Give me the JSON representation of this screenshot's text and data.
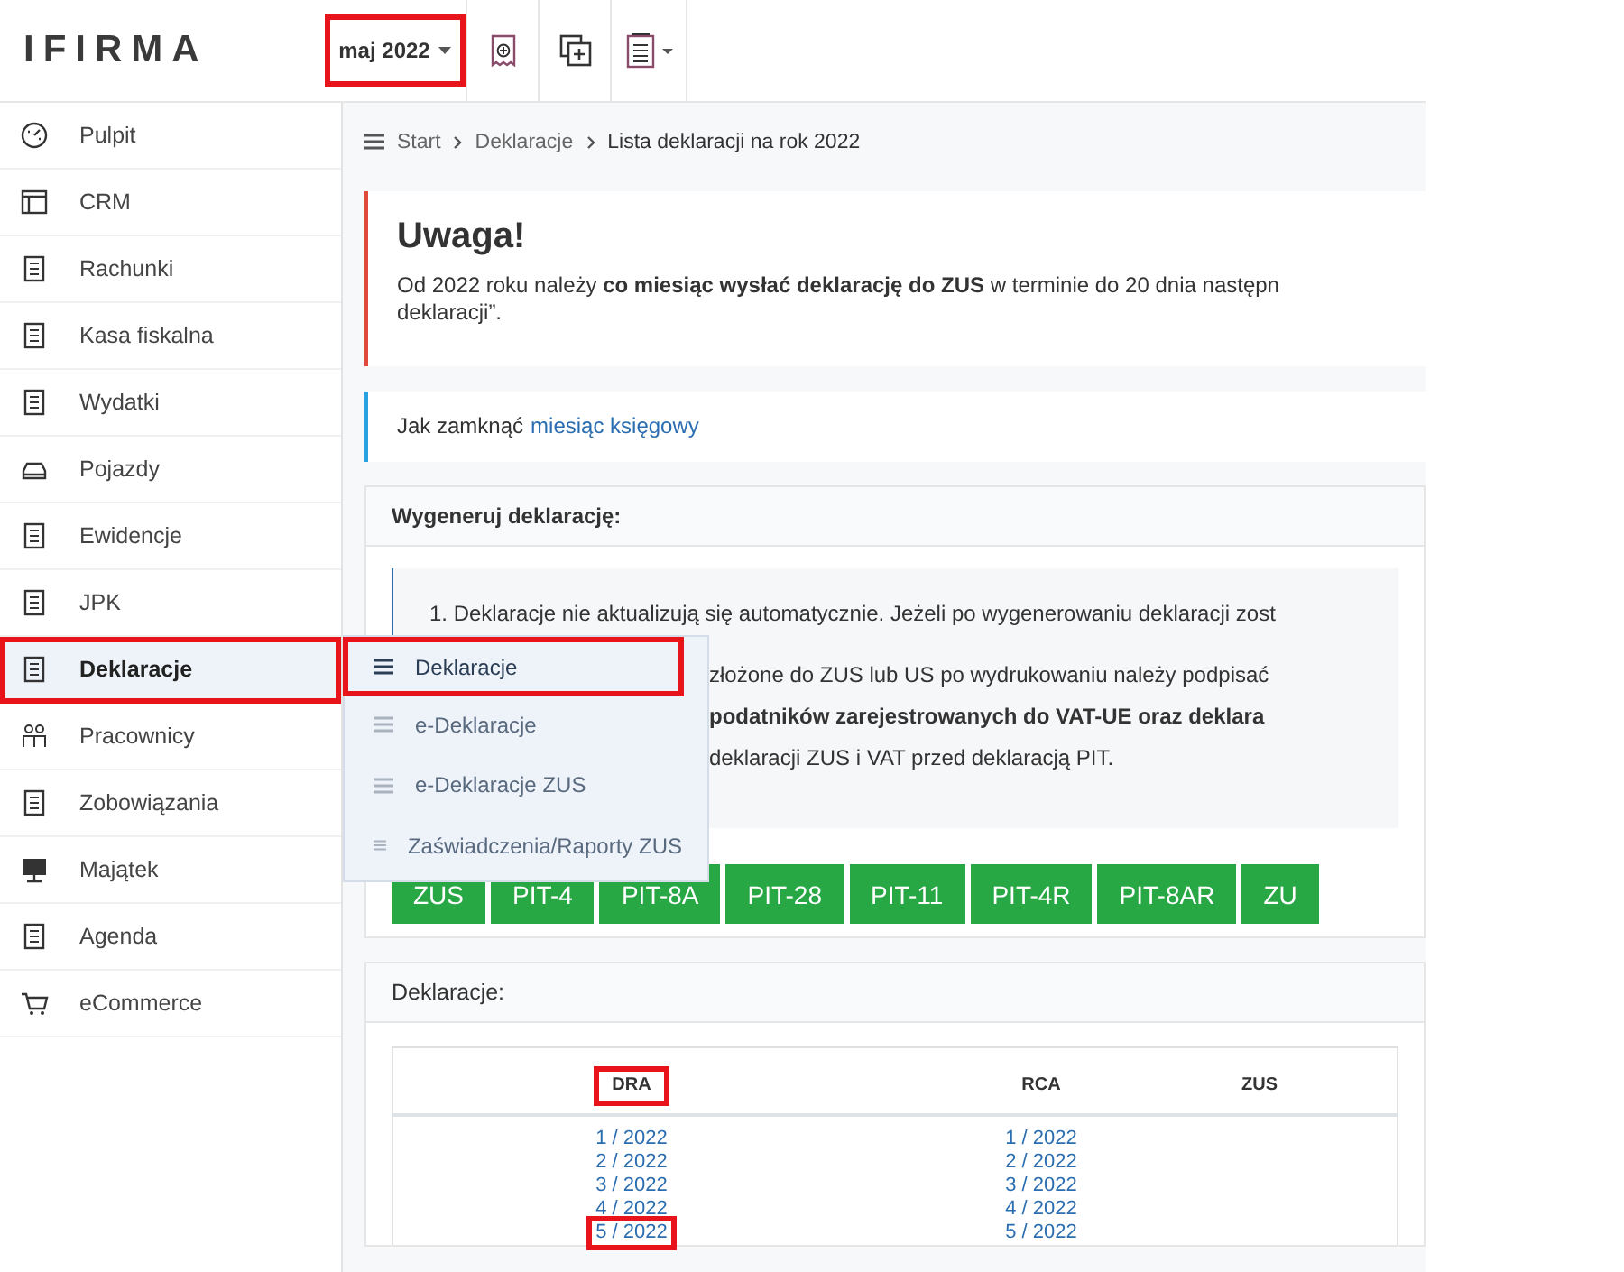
{
  "header": {
    "logo": "IFIRMA",
    "month": {
      "label": "maj 2022",
      "highlighted": true
    }
  },
  "sidebar": {
    "items": [
      {
        "label": "Pulpit",
        "selected": false,
        "highlighted": false
      },
      {
        "label": "CRM",
        "selected": false,
        "highlighted": false
      },
      {
        "label": "Rachunki",
        "selected": false,
        "highlighted": false
      },
      {
        "label": "Kasa fiskalna",
        "selected": false,
        "highlighted": false
      },
      {
        "label": "Wydatki",
        "selected": false,
        "highlighted": false
      },
      {
        "label": "Pojazdy",
        "selected": false,
        "highlighted": false
      },
      {
        "label": "Ewidencje",
        "selected": false,
        "highlighted": false
      },
      {
        "label": "JPK",
        "selected": false,
        "highlighted": false
      },
      {
        "label": "Deklaracje",
        "selected": true,
        "highlighted": true
      },
      {
        "label": "Pracownicy",
        "selected": false,
        "highlighted": false
      },
      {
        "label": "Zobowiązania",
        "selected": false,
        "highlighted": false
      },
      {
        "label": "Majątek",
        "selected": false,
        "highlighted": false
      },
      {
        "label": "Agenda",
        "selected": false,
        "highlighted": false
      },
      {
        "label": "eCommerce",
        "selected": false,
        "highlighted": false
      }
    ]
  },
  "submenu": [
    {
      "label": "Deklaracje",
      "selected": true,
      "highlighted": true
    },
    {
      "label": "e-Deklaracje",
      "selected": false,
      "highlighted": false
    },
    {
      "label": "e-Deklaracje ZUS",
      "selected": false,
      "highlighted": false
    },
    {
      "label": "Zaświadczenia/Raporty ZUS",
      "selected": false,
      "highlighted": false
    }
  ],
  "breadcrumb": [
    "Start",
    "Deklaracje",
    "Lista deklaracji na rok 2022"
  ],
  "notice": {
    "title": "Uwaga!",
    "lines": [
      "Od 2022 roku należy **co miesiąc wysłać deklarację do ZUS** w terminie do 20 dnia następn",
      "deklaracji”."
    ]
  },
  "info": {
    "text": "Jak zamknąć",
    "link": "miesiąc księgowy"
  },
  "generate": {
    "title": "Wygeneruj deklarację:",
    "notes": [
      "1. Deklaracje nie aktualizują się automatycznie. Jeżeli po wygenerowaniu deklaracji zost",
      "złożone do ZUS lub US po wydrukowaniu należy podpisać",
      "**podatników zarejestrowanych do VAT-UE oraz deklara**",
      "deklaracji ZUS i VAT przed deklaracją PIT."
    ],
    "buttons": [
      "ZUS",
      "PIT-4",
      "PIT-8A",
      "PIT-28",
      "PIT-11",
      "PIT-4R",
      "PIT-8AR",
      "ZU"
    ]
  },
  "declarations": {
    "title": "Deklaracje:",
    "columns": [
      {
        "label": "DRA",
        "highlighted": true
      },
      {
        "label": "RCA",
        "highlighted": false
      },
      {
        "label": "ZUS",
        "highlighted": false
      }
    ],
    "rows": [
      [
        {
          "text": "1 / 2022",
          "highlighted": false
        },
        {
          "text": "1 / 2022",
          "highlighted": false
        }
      ],
      [
        {
          "text": "2 / 2022",
          "highlighted": false
        },
        {
          "text": "2 / 2022",
          "highlighted": false
        }
      ],
      [
        {
          "text": "3 / 2022",
          "highlighted": false
        },
        {
          "text": "3 / 2022",
          "highlighted": false
        }
      ],
      [
        {
          "text": "4 / 2022",
          "highlighted": false
        },
        {
          "text": "4 / 2022",
          "highlighted": false
        }
      ],
      [
        {
          "text": "5 / 2022",
          "highlighted": true
        },
        {
          "text": "5 / 2022",
          "highlighted": false
        }
      ]
    ]
  }
}
